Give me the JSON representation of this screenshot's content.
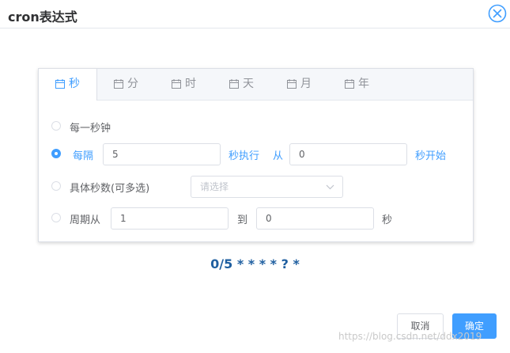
{
  "dialog": {
    "title": "cron表达式"
  },
  "tabs": [
    {
      "label": "秒",
      "active": true
    },
    {
      "label": "分",
      "active": false
    },
    {
      "label": "时",
      "active": false
    },
    {
      "label": "天",
      "active": false
    },
    {
      "label": "月",
      "active": false
    },
    {
      "label": "年",
      "active": false
    }
  ],
  "options": {
    "every": {
      "label": "每一秒钟",
      "checked": false
    },
    "interval": {
      "checked": true,
      "prefix": "每隔",
      "value": "5",
      "middle": "秒执行",
      "from_label": "从",
      "start_value": "0",
      "suffix": "秒开始"
    },
    "specific": {
      "checked": false,
      "label": "具体秒数(可多选)",
      "placeholder": "请选择"
    },
    "range": {
      "checked": false,
      "label": "周期从",
      "from_value": "1",
      "to_label": "到",
      "to_value": "0",
      "unit": "秒"
    }
  },
  "expression": "0/5 * * * * ? *",
  "buttons": {
    "cancel": "取消",
    "ok": "确定"
  },
  "watermark": "https://blog.csdn.net/ddx2019",
  "colors": {
    "accent": "#409eff",
    "expression": "#1f5fa0"
  }
}
